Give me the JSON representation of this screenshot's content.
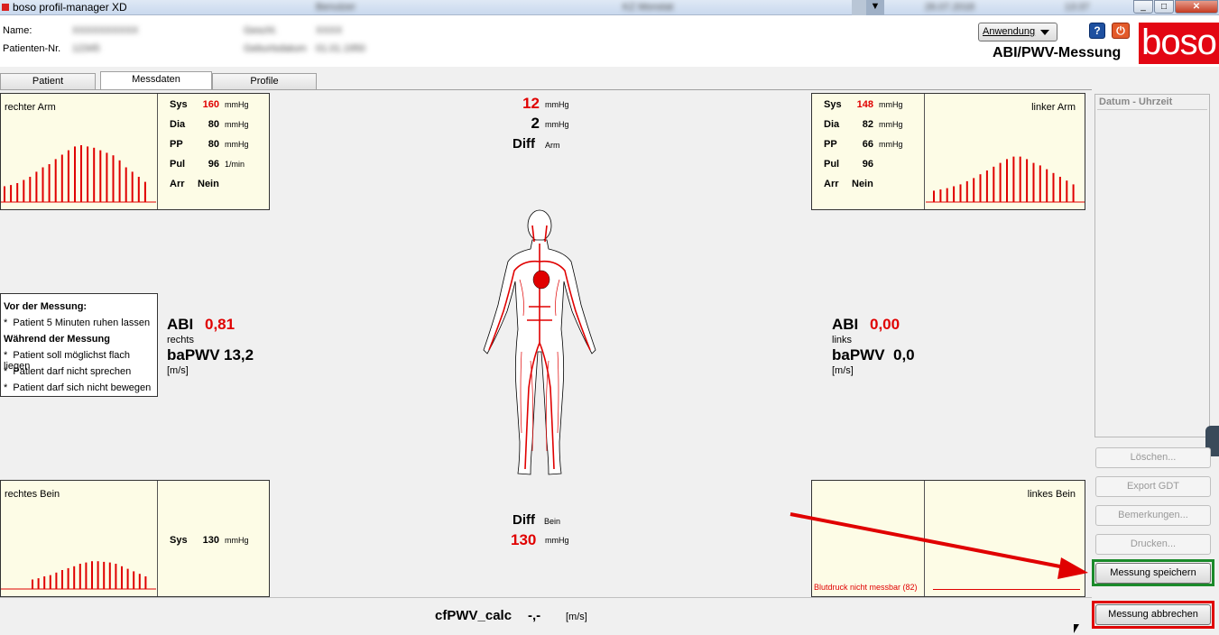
{
  "window": {
    "title": "boso profil-manager XD",
    "blur_1": "Benutzer",
    "blur_2": "KZ Monstat",
    "blur_3": "26.07.2018",
    "blur_4": "13:37"
  },
  "patient": {
    "name_label": "Name:",
    "name_value": "XXXXXXXXXX",
    "nr_label": "Patienten-Nr.",
    "nr_value": "12345",
    "g_label": "Geschl.",
    "g_value": "XXXX",
    "dob_label": "Geburtsdatum",
    "dob_value": "01.01.1950"
  },
  "header": {
    "app_title": "ABI/PWV-Messung",
    "logo": "boso",
    "dropdown_label": "Anwendung",
    "help": "?",
    "power": "⏻"
  },
  "tabs": [
    "Patient",
    "Messdaten",
    "Profile"
  ],
  "right_arm": {
    "label": "rechter Arm",
    "rows": [
      {
        "k": "Sys",
        "v": "160",
        "u": "mmHg",
        "red": true
      },
      {
        "k": "Dia",
        "v": "80",
        "u": "mmHg"
      },
      {
        "k": "PP",
        "v": "80",
        "u": "mmHg"
      },
      {
        "k": "Pul",
        "v": "96",
        "u": "1/min"
      },
      {
        "k": "Arr",
        "v": "Nein",
        "u": ""
      }
    ],
    "bars": [
      0.25,
      0.27,
      0.3,
      0.35,
      0.4,
      0.48,
      0.55,
      0.6,
      0.68,
      0.75,
      0.82,
      0.88,
      0.9,
      0.88,
      0.86,
      0.82,
      0.78,
      0.74,
      0.66,
      0.55,
      0.48,
      0.4,
      0.32
    ]
  },
  "left_arm": {
    "label": "linker Arm",
    "rows": [
      {
        "k": "Sys",
        "v": "148",
        "u": "mmHg",
        "red": true
      },
      {
        "k": "Dia",
        "v": "82",
        "u": "mmHg"
      },
      {
        "k": "PP",
        "v": "66",
        "u": "mmHg"
      },
      {
        "k": "Pul",
        "v": "96",
        "u": ""
      },
      {
        "k": "Arr",
        "v": "Nein",
        "u": ""
      }
    ],
    "bars": [
      0.18,
      0.2,
      0.22,
      0.25,
      0.28,
      0.33,
      0.38,
      0.44,
      0.5,
      0.56,
      0.62,
      0.68,
      0.72,
      0.72,
      0.68,
      0.62,
      0.58,
      0.52,
      0.46,
      0.4,
      0.34,
      0.28
    ]
  },
  "right_leg": {
    "label": "rechtes Bein",
    "rows": [
      {
        "k": "Sys",
        "v": "130",
        "u": "mmHg"
      }
    ],
    "bars": [
      0.15,
      0.17,
      0.2,
      0.22,
      0.26,
      0.3,
      0.33,
      0.36,
      0.4,
      0.42,
      0.44,
      0.44,
      0.43,
      0.42,
      0.4,
      0.36,
      0.32,
      0.28,
      0.24,
      0.2
    ]
  },
  "left_leg": {
    "label": "linkes Bein",
    "note": "Blutdruck nicht messbar (82)"
  },
  "center_top": {
    "diff_sys": "12",
    "diff_sys_unit": "mmHg",
    "diff_dia": "2",
    "diff_dia_unit": "mmHg",
    "diff_label": "Diff",
    "diff_sub": "Arm"
  },
  "center_bottom": {
    "diff_label": "Diff",
    "diff_sub": "Bein",
    "value": "130",
    "unit": "mmHg"
  },
  "abi_right": {
    "abi_label": "ABI",
    "abi_value": "0,81",
    "side": "rechts",
    "pwv_label": "baPWV",
    "pwv_value": "13,2",
    "pwv_unit": "[m/s]"
  },
  "abi_left": {
    "abi_label": "ABI",
    "abi_value": "0,00",
    "side": "links",
    "pwv_label": "baPWV",
    "pwv_value": "0,0",
    "pwv_unit": "[m/s]"
  },
  "instructions": {
    "h1": "Vor der Messung:",
    "i1": "Patient 5 Minuten ruhen lassen",
    "h2": "Während der Messung",
    "i2": "Patient soll möglichst flach liegen",
    "i3": "Patient darf nicht sprechen",
    "i4": "Patient darf sich nicht bewegen",
    "bullet": "*"
  },
  "cfpwv": {
    "label": "cfPWV_calc",
    "value": "-,-",
    "unit": "[m/s]"
  },
  "sidebar": {
    "list_header": "Datum - Uhrzeit",
    "btn_delete": "Löschen...",
    "btn_export": "Export GDT",
    "btn_notes": "Bemerkungen...",
    "btn_print": "Drucken...",
    "btn_save": "Messung speichern",
    "btn_cancel": "Messung abbrechen"
  },
  "colors": {
    "accent_red": "#e30613",
    "value_red": "#e00000",
    "panel_bg": "#fdfce6",
    "save_highlight": "#1a8a2a",
    "cancel_highlight": "#e00000"
  }
}
